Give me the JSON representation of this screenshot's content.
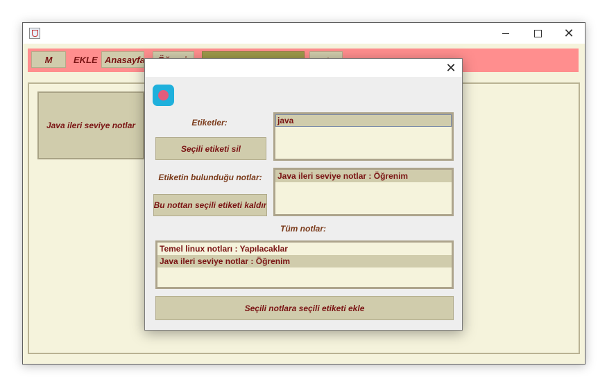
{
  "window": {
    "icon": "java-cup-icon",
    "controls": {
      "minimize": "minimize-icon",
      "maximize": "maximize-icon",
      "close": "close-icon"
    }
  },
  "toolbar": {
    "m_label": "M",
    "ekle_label": "EKLE",
    "anasayfa_label": "Anasayfa",
    "ogrenim_label": "Öğrenim",
    "back_label": "<"
  },
  "main": {
    "note_card": "Java ileri seviye notlar"
  },
  "dialog": {
    "close_glyph": "✕",
    "etiketler_label": "Etiketler:",
    "tags": [
      {
        "label": "java"
      }
    ],
    "delete_tag_button": "Seçili etiketi sil",
    "tag_notes_label": "Etiketin bulunduğu notlar:",
    "tag_notes": [
      {
        "label": "Java ileri seviye notlar : Öğrenim"
      }
    ],
    "remove_tag_button": "Bu nottan seçili etiketi kaldır",
    "all_notes_label": "Tüm notlar:",
    "all_notes": [
      {
        "label": "Temel linux notları : Yapılacaklar"
      },
      {
        "label": "Java ileri seviye notlar : Öğrenim"
      }
    ],
    "add_tag_button": "Seçili notlara seçili etiketi ekle"
  },
  "colors": {
    "toolbar_bg": "#ff8e8e",
    "panel_bg": "#f5f3dc",
    "button_bg": "#d0ccac",
    "text": "#7a1414",
    "dialog_icon": "#1fb0dc"
  }
}
